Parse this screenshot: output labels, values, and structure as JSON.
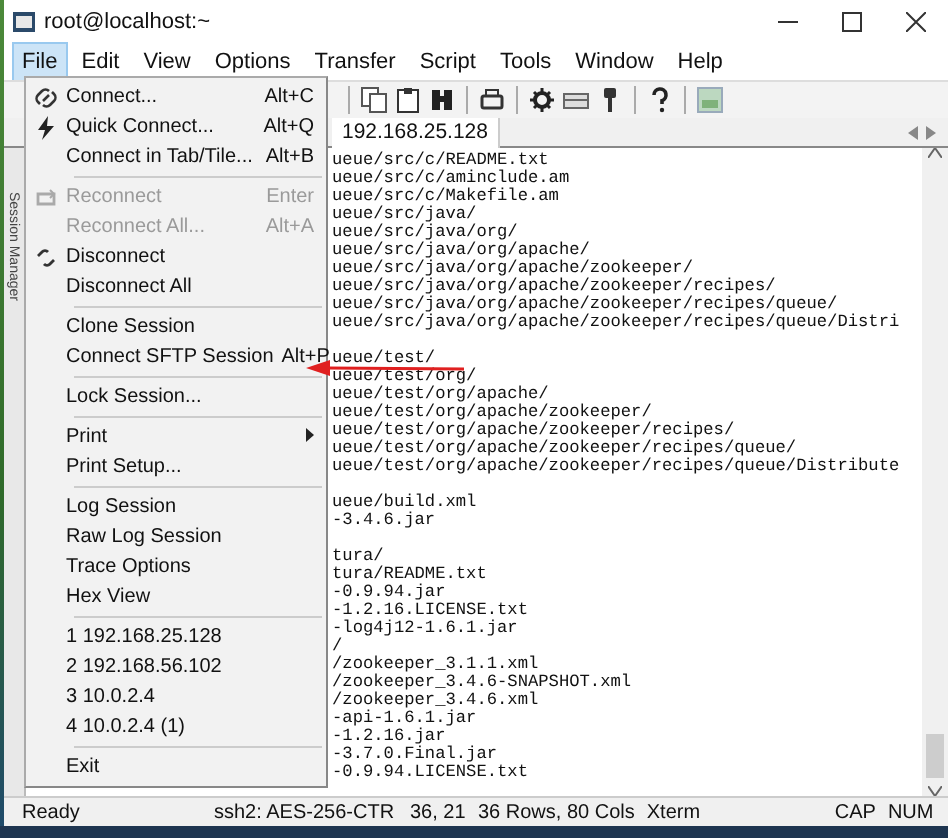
{
  "window": {
    "title": "root@localhost:~"
  },
  "menubar": [
    {
      "label": "File",
      "selected": true
    },
    {
      "label": "Edit",
      "selected": false
    },
    {
      "label": "View",
      "selected": false
    },
    {
      "label": "Options",
      "selected": false
    },
    {
      "label": "Transfer",
      "selected": false
    },
    {
      "label": "Script",
      "selected": false
    },
    {
      "label": "Tools",
      "selected": false
    },
    {
      "label": "Window",
      "selected": false
    },
    {
      "label": "Help",
      "selected": false
    }
  ],
  "file_menu": [
    {
      "kind": "item",
      "label": "Connect...",
      "shortcut": "Alt+C",
      "disabled": false
    },
    {
      "kind": "item",
      "label": "Quick Connect...",
      "shortcut": "Alt+Q",
      "disabled": false
    },
    {
      "kind": "item",
      "label": "Connect in Tab/Tile...",
      "shortcut": "Alt+B",
      "disabled": false
    },
    {
      "kind": "separator"
    },
    {
      "kind": "item",
      "label": "Reconnect",
      "shortcut": "Enter",
      "disabled": true
    },
    {
      "kind": "item",
      "label": "Reconnect All...",
      "shortcut": "Alt+A",
      "disabled": true
    },
    {
      "kind": "item",
      "label": "Disconnect",
      "disabled": false
    },
    {
      "kind": "item",
      "label": "Disconnect All",
      "disabled": false
    },
    {
      "kind": "separator"
    },
    {
      "kind": "item",
      "label": "Clone Session",
      "disabled": false
    },
    {
      "kind": "item",
      "label": "Connect SFTP Session",
      "shortcut": "Alt+P",
      "disabled": false
    },
    {
      "kind": "separator"
    },
    {
      "kind": "item",
      "label": "Lock Session...",
      "disabled": false
    },
    {
      "kind": "separator"
    },
    {
      "kind": "item",
      "label": "Print",
      "disabled": false,
      "submenu": true
    },
    {
      "kind": "item",
      "label": "Print Setup...",
      "disabled": false
    },
    {
      "kind": "separator"
    },
    {
      "kind": "item",
      "label": "Log Session",
      "disabled": false
    },
    {
      "kind": "item",
      "label": "Raw Log Session",
      "disabled": false
    },
    {
      "kind": "item",
      "label": "Trace Options",
      "disabled": false
    },
    {
      "kind": "item",
      "label": "Hex View",
      "disabled": false
    },
    {
      "kind": "separator"
    },
    {
      "kind": "item",
      "label": "1 192.168.25.128",
      "disabled": false
    },
    {
      "kind": "item",
      "label": "2 192.168.56.102",
      "disabled": false
    },
    {
      "kind": "item",
      "label": "3 10.0.2.4",
      "disabled": false
    },
    {
      "kind": "item",
      "label": "4 10.0.2.4 (1)",
      "disabled": false
    },
    {
      "kind": "separator"
    },
    {
      "kind": "item",
      "label": "Exit",
      "disabled": false
    }
  ],
  "session_manager": {
    "label": "Session Manager"
  },
  "tabs": [
    {
      "label": "192.168.25.128",
      "selected": true
    }
  ],
  "terminal": {
    "blocks": [
      [
        "ueue/src/c/README.txt",
        "ueue/src/c/aminclude.am",
        "ueue/src/c/Makefile.am",
        "ueue/src/java/",
        "ueue/src/java/org/",
        "ueue/src/java/org/apache/",
        "ueue/src/java/org/apache/zookeeper/",
        "ueue/src/java/org/apache/zookeeper/recipes/",
        "ueue/src/java/org/apache/zookeeper/recipes/queue/",
        "ueue/src/java/org/apache/zookeeper/recipes/queue/Distri"
      ],
      [
        "ueue/test/",
        "ueue/test/org/",
        "ueue/test/org/apache/",
        "ueue/test/org/apache/zookeeper/",
        "ueue/test/org/apache/zookeeper/recipes/",
        "ueue/test/org/apache/zookeeper/recipes/queue/",
        "ueue/test/org/apache/zookeeper/recipes/queue/Distribute"
      ],
      [
        "ueue/build.xml",
        "-3.4.6.jar"
      ],
      [
        "tura/",
        "tura/README.txt",
        "-0.9.94.jar",
        "-1.2.16.LICENSE.txt",
        "-log4j12-1.6.1.jar",
        "/",
        "/zookeeper_3.1.1.xml",
        "/zookeeper_3.4.6-SNAPSHOT.xml",
        "/zookeeper_3.4.6.xml",
        "-api-1.6.1.jar",
        "-1.2.16.jar",
        "-3.7.0.Final.jar",
        "-0.9.94.LICENSE.txt"
      ]
    ]
  },
  "status_bar": [
    {
      "text": "Ready"
    },
    {
      "text": "ssh2: AES-256-CTR"
    },
    {
      "text": "36,  21"
    },
    {
      "text": "36 Rows, 80 Cols"
    },
    {
      "text": "Xterm"
    },
    {
      "text": "CAP"
    },
    {
      "text": "NUM"
    }
  ]
}
